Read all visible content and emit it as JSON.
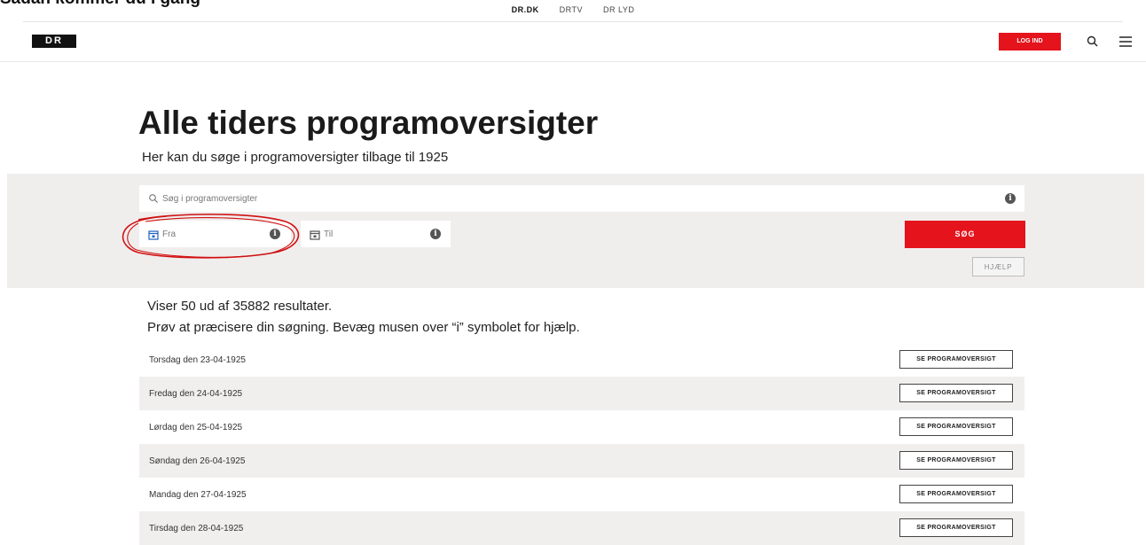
{
  "doc_caption": "Sådan kommer du i gang",
  "topnav": [
    "DR.DK",
    "DRTV",
    "DR LYD"
  ],
  "logo": "DR",
  "header": {
    "login_label": "LOG IND"
  },
  "page": {
    "title": "Alle tiders programoversigter",
    "subtitle": "Her kan du søge i programoversigter tilbage til 1925"
  },
  "search": {
    "placeholder": "Søg i programoversigter",
    "from_placeholder": "Fra",
    "to_placeholder": "Til",
    "search_label": "SØG",
    "help_label": "HJÆLP",
    "info_glyph": "i"
  },
  "results": {
    "count_text": "Viser 50 ud af 35882 resultater.",
    "hint_text": "Prøv at præcisere din søgning. Bevæg musen over “i” symbolet for hjælp.",
    "button_label": "SE PROGRAMOVERSIGT",
    "rows": [
      "Torsdag den 23-04-1925",
      "Fredag den 24-04-1925",
      "Lørdag den 25-04-1925",
      "Søndag den 26-04-1925",
      "Mandag den 27-04-1925",
      "Tirsdag den 28-04-1925"
    ]
  },
  "colors": {
    "accent": "#e4131c",
    "band": "#f0eded",
    "annotation": "#d01010"
  }
}
